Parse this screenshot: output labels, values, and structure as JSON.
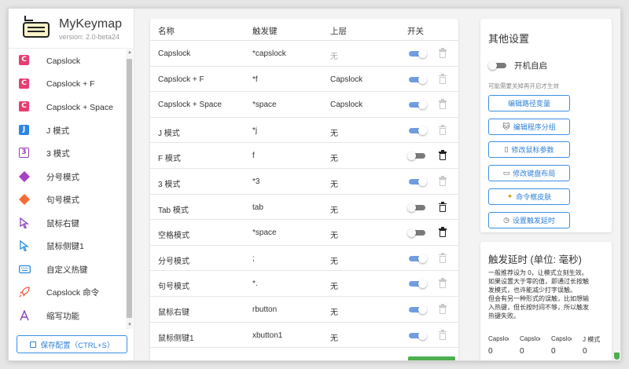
{
  "app": {
    "title": "MyKeymap",
    "version": "version: 2.0-beta24"
  },
  "sidebar": {
    "items": [
      {
        "label": "Capslock",
        "icon": "c-badge-icon",
        "glyph": "C",
        "color": "#e83d71"
      },
      {
        "label": "Capslock + F",
        "icon": "c-badge-icon",
        "glyph": "C",
        "color": "#e83d71"
      },
      {
        "label": "Capslock + Space",
        "icon": "c-badge-icon",
        "glyph": "C",
        "color": "#e83d71"
      },
      {
        "label": "J 模式",
        "icon": "j-badge-icon",
        "glyph": "J",
        "color": "#2f86e6"
      },
      {
        "label": "3 模式",
        "icon": "3-badge-icon",
        "glyph": "3",
        "color": "#9b3db8"
      },
      {
        "label": "分号模式",
        "icon": "purple-diamond-icon",
        "glyph": "",
        "color": "#a640c4"
      },
      {
        "label": "句号模式",
        "icon": "orange-diamond-icon",
        "glyph": "",
        "color": "#f36d33"
      },
      {
        "label": "鼠标右键",
        "icon": "purple-cursor-icon",
        "glyph": "",
        "color": "#8c3fbd"
      },
      {
        "label": "鼠标侧键1",
        "icon": "blue-cursor-icon",
        "glyph": "",
        "color": "#2a8be0"
      },
      {
        "label": "自定义热键",
        "icon": "keyboard-icon",
        "glyph": "",
        "color": "#2a8be0"
      },
      {
        "label": "Capslock 命令",
        "icon": "rocket-icon",
        "glyph": "",
        "color": "#f05a3c"
      },
      {
        "label": "缩写功能",
        "icon": "a-letter-icon",
        "glyph": "A",
        "color": "#8c3fbd"
      }
    ],
    "save_label": "保存配置（CTRL+S）"
  },
  "table": {
    "headers": [
      "名称",
      "触发键",
      "上层",
      "开关"
    ],
    "rows": [
      {
        "name": "Capslock",
        "trigger": "*capslock",
        "layer": "无",
        "layer_muted": true,
        "enabled": true,
        "deletable": false
      },
      {
        "name": "Capslock + F",
        "trigger": "*f",
        "layer": "Capslock",
        "layer_muted": false,
        "enabled": true,
        "deletable": false
      },
      {
        "name": "Capslock + Space",
        "trigger": "*space",
        "layer": "Capslock",
        "layer_muted": false,
        "enabled": true,
        "deletable": false
      },
      {
        "name": "J 模式",
        "trigger": "*j",
        "layer": "无",
        "layer_muted": false,
        "enabled": true,
        "deletable": false
      },
      {
        "name": "F 模式",
        "trigger": "f",
        "layer": "无",
        "layer_muted": false,
        "enabled": false,
        "deletable": true
      },
      {
        "name": "3 模式",
        "trigger": "*3",
        "layer": "无",
        "layer_muted": false,
        "enabled": true,
        "deletable": false
      },
      {
        "name": "Tab 模式",
        "trigger": "tab",
        "layer": "无",
        "layer_muted": false,
        "enabled": false,
        "deletable": true
      },
      {
        "name": "空格模式",
        "trigger": "*space",
        "layer": "无",
        "layer_muted": false,
        "enabled": false,
        "deletable": true
      },
      {
        "name": "分号模式",
        "trigger": ";",
        "layer": "无",
        "layer_muted": false,
        "enabled": true,
        "deletable": false
      },
      {
        "name": "句号模式",
        "trigger": "*.",
        "layer": "无",
        "layer_muted": false,
        "enabled": true,
        "deletable": false
      },
      {
        "name": "鼠标右键",
        "trigger": "rbutton",
        "layer": "无",
        "layer_muted": false,
        "enabled": true,
        "deletable": false
      },
      {
        "name": "鼠标侧键1",
        "trigger": "xbutton1",
        "layer": "无",
        "layer_muted": false,
        "enabled": true,
        "deletable": false
      }
    ]
  },
  "settings": {
    "title": "其他设置",
    "autostart_label": "开机自启",
    "hint": "可能需要关掉再开启才生效",
    "buttons": [
      {
        "label": "编辑路径变量",
        "icon": ""
      },
      {
        "label": "编辑程序分组",
        "icon": "🐱"
      },
      {
        "label": "修改鼠标参数",
        "icon": "mouse-icon"
      },
      {
        "label": "修改键盘布局",
        "icon": "keyboard-icon"
      },
      {
        "label": "命令框皮肤",
        "icon": "sparkle-icon"
      },
      {
        "label": "设置触发延时",
        "icon": "clock-icon"
      }
    ]
  },
  "delay": {
    "title": "触发延时 (单位: 毫秒)",
    "desc_lines": [
      "一般推荐设为 0，让模式立刻生效。",
      "如果设置大于零的值，即通过长按触",
      "发模式，也许能减少打字误触。",
      "但会有另一种形式的误触，比如想输",
      "入热键，但长按时间不够，所以触发",
      "热键失败。"
    ],
    "columns": [
      "Capslock",
      "Capslock + F",
      "Capslock + Space",
      "J 模式"
    ],
    "values": [
      "0",
      "0",
      "0",
      "0"
    ]
  }
}
